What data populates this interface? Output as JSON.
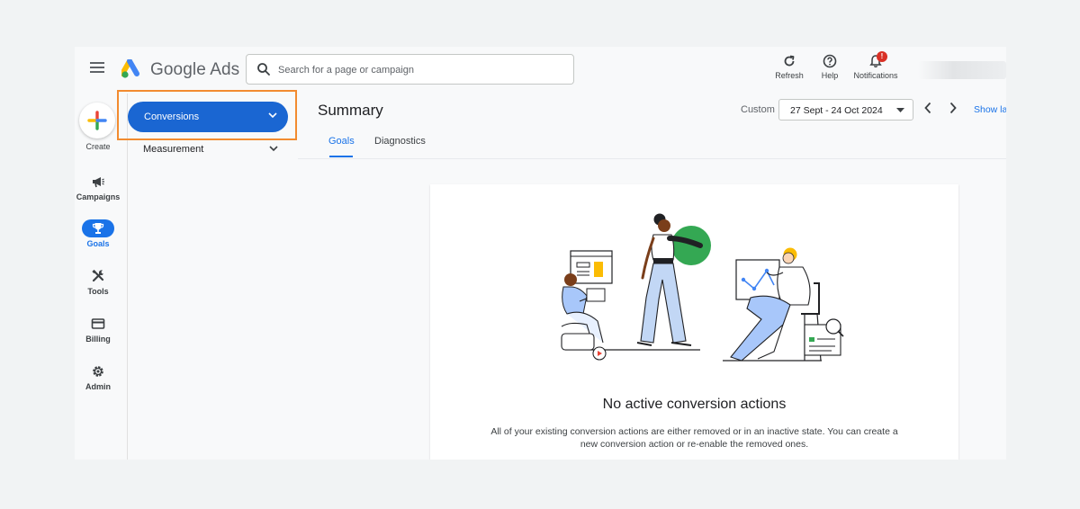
{
  "header": {
    "logo_text": "Google Ads",
    "search_placeholder": "Search for a page or campaign",
    "actions": {
      "refresh": "Refresh",
      "help": "Help",
      "notifications": "Notifications",
      "notifications_badge": "!"
    }
  },
  "rail": {
    "create": "Create",
    "items": [
      {
        "label": "Campaigns",
        "icon": "megaphone-icon"
      },
      {
        "label": "Goals",
        "icon": "trophy-icon",
        "active": true
      },
      {
        "label": "Tools",
        "icon": "tools-icon"
      },
      {
        "label": "Billing",
        "icon": "credit-card-icon"
      },
      {
        "label": "Admin",
        "icon": "gear-icon"
      }
    ]
  },
  "subnav": {
    "conversions": "Conversions",
    "measurement": "Measurement"
  },
  "main": {
    "title": "Summary",
    "date_range_label": "Custom",
    "date_range_value": "27 Sept - 24 Oct 2024",
    "show_last": "Show la",
    "tabs": [
      {
        "label": "Goals",
        "active": true
      },
      {
        "label": "Diagnostics",
        "active": false
      }
    ]
  },
  "empty_state": {
    "title": "No active conversion actions",
    "description": "All of your existing conversion actions are either removed or in an inactive state. You can create a new conversion action or re-enable the removed ones."
  },
  "colors": {
    "primary": "#1a73e8",
    "conversions_button": "#1a66d2",
    "highlight": "#f28b30",
    "badge": "#d93025"
  }
}
